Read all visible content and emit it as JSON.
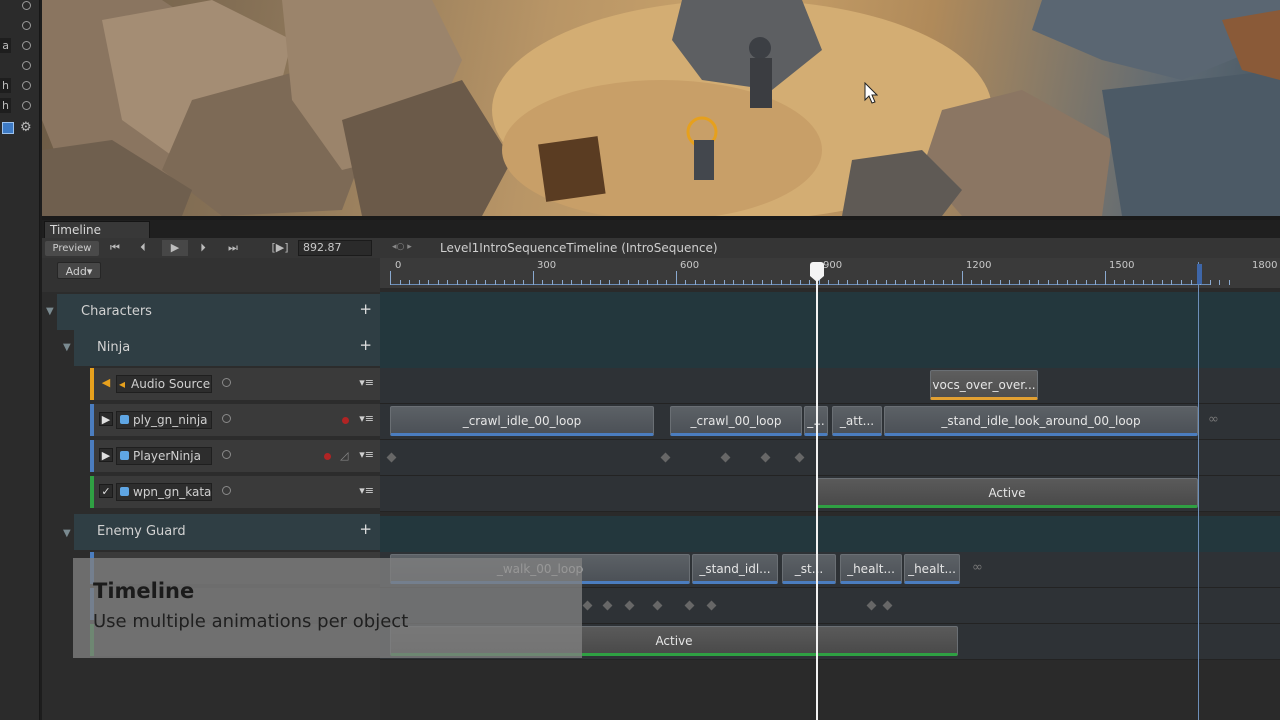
{
  "left_strip": {
    "rows": [
      {
        "letter": "",
        "kind": "radio"
      },
      {
        "letter": "",
        "kind": "radio"
      },
      {
        "letter": "a",
        "kind": "radio"
      },
      {
        "letter": "",
        "kind": "radio"
      },
      {
        "letter": "h",
        "kind": "radio"
      },
      {
        "letter": "h",
        "kind": "radio"
      }
    ]
  },
  "timeline": {
    "tab_label": "Timeline",
    "preview_label": "Preview",
    "controls": {
      "first": "⏮",
      "prev": "⏴",
      "play": "▶",
      "next": "⏵",
      "last": "⏭",
      "frame": "[▶]"
    },
    "current_time": "892.87",
    "asset_label": "Level1IntroSequenceTimeline (IntroSequence)",
    "add_label": "Add▾",
    "ruler_ticks": [
      "0",
      "300",
      "600",
      "900",
      "1200",
      "1500",
      "1800"
    ]
  },
  "tracks": {
    "group_characters": "Characters",
    "group_ninja": "Ninja",
    "group_enemy_guard": "Enemy Guard",
    "plus": "+",
    "audio_source": "Audio Source",
    "ply_gn_ninja": "ply_gn_ninja",
    "player_ninja": "PlayerNinja",
    "wpn_gn_kata": "wpn_gn_kata",
    "check": "✓",
    "menu": "▾≡",
    "infinite": "∞"
  },
  "clips": {
    "audio": "vocs_over_over...",
    "ninja": [
      "_crawl_idle_00_loop",
      "_crawl_00_loop",
      "_...",
      "_att...",
      "_stand_idle_look_around_00_loop"
    ],
    "active": "Active",
    "enemy": [
      "_walk_00_loop",
      "_stand_idl...",
      "_st...",
      "_healt...",
      "_healt..."
    ],
    "enemy_active": "Active"
  },
  "caption": {
    "title": "Timeline",
    "subtitle": "Use multiple animations per object"
  },
  "colors": {
    "playhead": "#f2f2f2",
    "anim_clip_underline": "#4b7dbf",
    "audio_clip_underline": "#e2a032",
    "active_clip_underline": "#2fa043",
    "record": "#b02424"
  }
}
